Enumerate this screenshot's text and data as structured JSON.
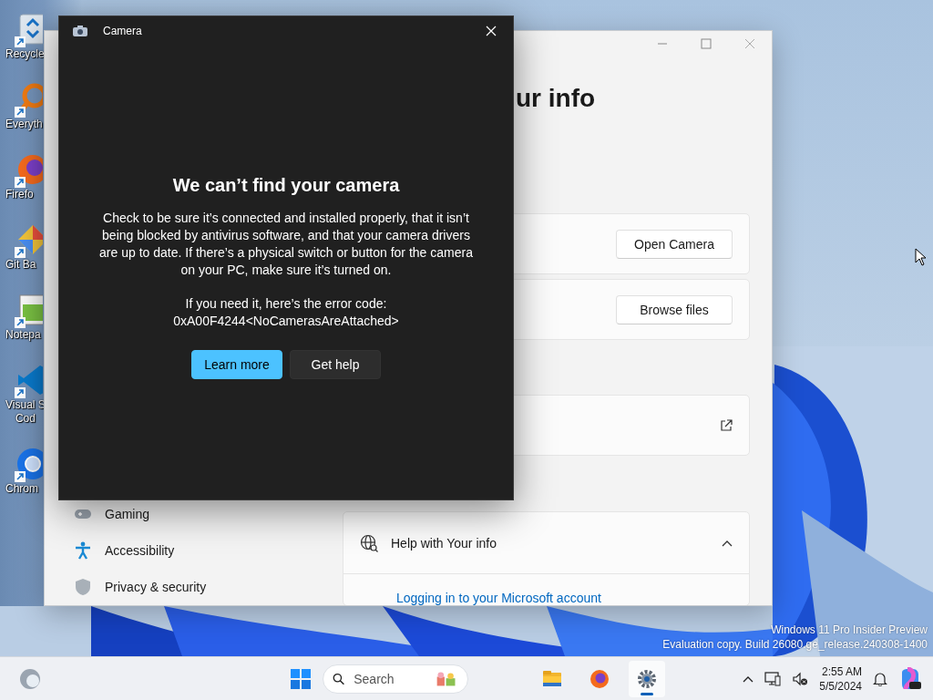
{
  "desktop_icons": [
    {
      "kind": "recycle",
      "label_lines": [
        "Recycle"
      ]
    },
    {
      "kind": "everything",
      "label_lines": [
        "Everyth"
      ]
    },
    {
      "kind": "firefox",
      "label_lines": [
        "Firefo"
      ]
    },
    {
      "kind": "git",
      "label_lines": [
        "Git Ba"
      ]
    },
    {
      "kind": "notepad",
      "label_lines": [
        "Notepa"
      ]
    },
    {
      "kind": "vscode",
      "label_lines": [
        "Visual S",
        "Cod"
      ]
    },
    {
      "kind": "chrome",
      "label_lines": [
        "Chrom"
      ]
    }
  ],
  "settings_window": {
    "heading": "ur info",
    "nav_items": [
      {
        "kind": "gaming",
        "label": "Gaming"
      },
      {
        "kind": "accessibility",
        "label": "Accessibility"
      },
      {
        "kind": "privacy",
        "label": "Privacy & security"
      }
    ],
    "cards": [
      {
        "kind": "button",
        "button": "Open Camera"
      },
      {
        "kind": "button",
        "button": "Browse files"
      },
      {
        "kind": "external"
      }
    ],
    "help_section": {
      "title": "Help with Your info",
      "expanded": true,
      "links": [
        "Logging in to your Microsoft account"
      ]
    }
  },
  "camera_window": {
    "title": "Camera",
    "heading": "We can’t find your camera",
    "message": "Check to be sure it’s connected and installed properly, that it isn’t being blocked by antivirus software, and that your camera drivers are up to date. If there’s a physical switch or button for the camera on your PC, make sure it’s turned on.",
    "error_intro": "If you need it, here’s the error code:",
    "error_code": "0xA00F4244<NoCamerasAreAttached>",
    "buttons": [
      {
        "kind": "primary",
        "label": "Learn more"
      },
      {
        "kind": "secondary",
        "label": "Get help"
      }
    ]
  },
  "watermark_lines": [
    "Windows 11 Pro Insider Preview",
    "Evaluation copy. Build 26080.ge_release.240308-1400"
  ],
  "taskbar": {
    "search": {
      "placeholder": "Search"
    },
    "apps": [
      {
        "kind": "folder",
        "selected": false
      },
      {
        "kind": "firefox",
        "selected": false
      },
      {
        "kind": "settings",
        "selected": true
      }
    ],
    "clock": {
      "time": "2:55 AM",
      "date": "5/5/2024"
    }
  }
}
